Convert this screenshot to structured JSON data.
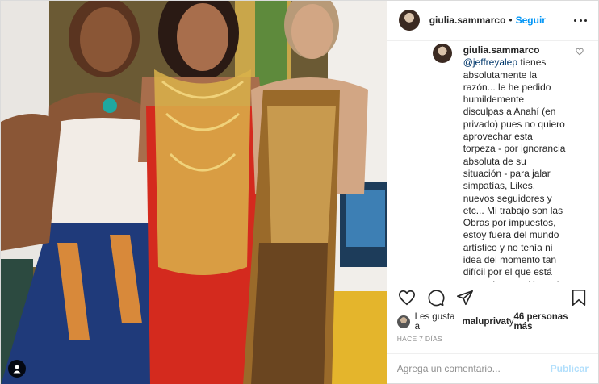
{
  "header": {
    "username": "giulia.sammarco",
    "separator": "•",
    "follow_label": "Seguir"
  },
  "comment": {
    "username": "giulia.sammarco",
    "mention": "@jeffreyalep",
    "text": " tienes absolutamente la razón... le he pedido humildemente disculpas a Anahí (en privado) pues no quiero aprovechar esta torpeza - por ignorancia absoluta de su situación - para jalar simpatías, Likes, nuevos seguidores y etc... Mi trabajo son las Obras por impuestos, estoy fuera del mundo artístico y no tenía ni idea del momento tan difícil por el que está pasando... perdón es lo único que puedo decir, ella no debió ser"
  },
  "likes": {
    "prefix": "Les gusta a ",
    "user": "maluprivat",
    "middle": " y ",
    "others": "46 personas más"
  },
  "date": "HACE 7 DÍAS",
  "add_comment": {
    "placeholder": "Agrega un comentario...",
    "publish_label": "Publicar"
  },
  "icons": {
    "like": "heart-icon",
    "comment": "comment-icon",
    "share": "share-icon",
    "save": "bookmark-icon",
    "tag": "user-tag-icon",
    "more": "more-options-icon"
  },
  "colors": {
    "link_blue": "#0095f6",
    "publish_disabled": "#b2dffc",
    "meta_gray": "#8e8e8e"
  }
}
